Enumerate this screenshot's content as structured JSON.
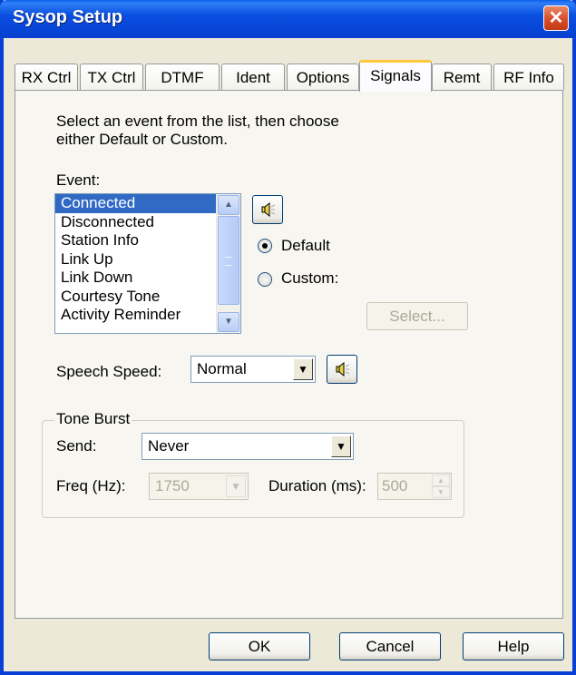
{
  "window": {
    "title": "Sysop Setup"
  },
  "tabs": [
    {
      "label": "RX Ctrl",
      "active": false
    },
    {
      "label": "TX Ctrl",
      "active": false
    },
    {
      "label": "DTMF",
      "active": false
    },
    {
      "label": "Ident",
      "active": false
    },
    {
      "label": "Options",
      "active": false
    },
    {
      "label": "Signals",
      "active": true
    },
    {
      "label": "Remt",
      "active": false
    },
    {
      "label": "RF Info",
      "active": false
    }
  ],
  "signals": {
    "instructions_line1": "Select an event from the list, then choose",
    "instructions_line2": "either Default or Custom.",
    "event_label": "Event:",
    "events": [
      "Connected",
      "Disconnected",
      "Station Info",
      "Link Up",
      "Link Down",
      "Courtesy Tone",
      "Activity Reminder"
    ],
    "selected_event": "Connected",
    "default_label": "Default",
    "custom_label": "Custom:",
    "selected_option": "Default",
    "select_button": "Select...",
    "speech_speed_label": "Speech Speed:",
    "speech_speed_value": "Normal"
  },
  "tone_burst": {
    "group_label": "Tone Burst",
    "send_label": "Send:",
    "send_value": "Never",
    "freq_label": "Freq (Hz):",
    "freq_value": "1750",
    "duration_label": "Duration (ms):",
    "duration_value": "500"
  },
  "footer": {
    "ok": "OK",
    "cancel": "Cancel",
    "help": "Help"
  },
  "icons": {
    "close": "close-icon",
    "speaker": "speaker-icon"
  }
}
